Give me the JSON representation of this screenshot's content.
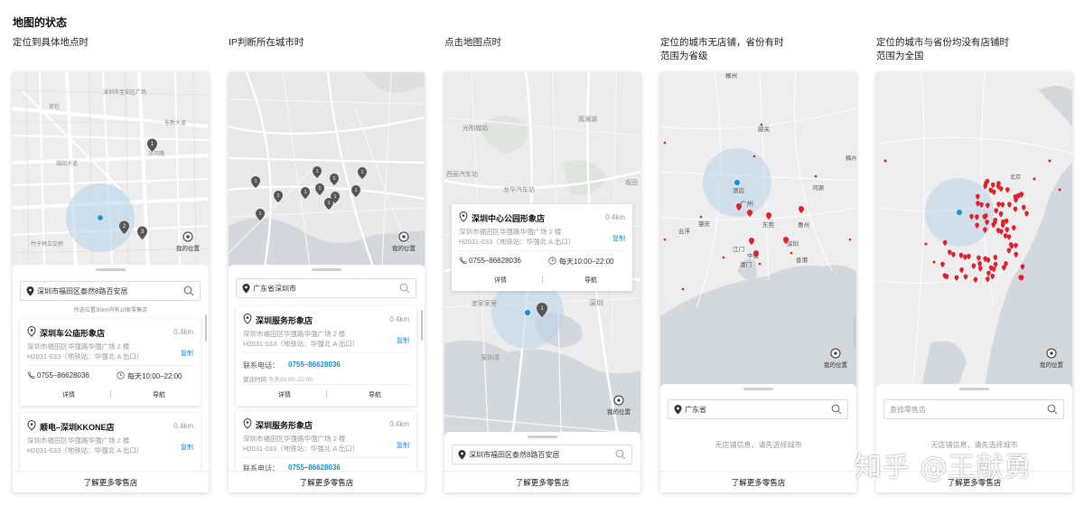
{
  "title": "地图的状态",
  "columns": [
    {
      "caption": [
        "定位到具体地点时"
      ],
      "map_labels": [
        "深圳市宝安区广场",
        "荷包",
        "福田大道",
        "沙河路",
        "东新大道",
        "竹子林立交桥"
      ],
      "search": "深圳市福田区泰然8路百安居",
      "hint": "所选位置30km内有10家零售店",
      "my_location": "我的位置",
      "stores": [
        {
          "name": "深圳车公庙形象店",
          "distance": "0.4km",
          "address": [
            "深圳市福田区华强路华强广场 2 楼",
            "H2031-033（地铁站：华强北 A 出口）"
          ],
          "copy": "复制",
          "phone": "0755–86628036",
          "hours": "每天10:00–22:00",
          "detail": "详情",
          "nav": "导航"
        },
        {
          "name": "顺电–深圳KKONE店",
          "distance": "0.4km",
          "address": [
            "深圳市福田区华强路华强广场 2 楼",
            "H2031-033（地铁站：华强北 A 出口）"
          ],
          "copy": "复制"
        }
      ],
      "cluster_counts": [
        "1",
        "2",
        "3"
      ],
      "footer": "了解更多零售店"
    },
    {
      "caption": [
        "IP判断所在城市时"
      ],
      "search": "广东省深圳市",
      "my_location": "我的位置",
      "cluster_counts": [
        "1",
        "1",
        "1",
        "1",
        "1",
        "1",
        "1",
        "1",
        "1",
        "1",
        "1"
      ],
      "stores": [
        {
          "name": "深圳服务形象店",
          "distance": "0.4km",
          "address": [
            "深圳市福田区华强路华强广场 2 楼",
            "H2031-033（地铁站：华强北 A 出口）"
          ],
          "copy": "复制",
          "contact_label": "联系电话：",
          "contact": "0755–86628036",
          "biz_label": "营业时间",
          "biz_hours": "今天10:00–22:00",
          "detail": "详情",
          "nav": "导航"
        },
        {
          "name": "深圳服务形象店",
          "distance": "0.4km",
          "address": [
            "深圳市福田区华强路华强广场 2 楼",
            "H2031-033（地铁站：华强北 A 出口）"
          ],
          "copy": "复制",
          "contact_label": "联系电话：",
          "contact": "0755–86628036"
        }
      ],
      "footer": "了解更多零售店"
    },
    {
      "caption": [
        "点击地图点时"
      ],
      "map_labels": [
        "观澜湖",
        "光明城站",
        "西丽汽车站",
        "龙华汽车站",
        "坂田",
        "深圳",
        "宜家家居",
        "深圳湾"
      ],
      "popup": {
        "name": "深圳中心公园形象店",
        "distance": "0.4km",
        "address": [
          "深圳市福田区华强路华强广场 2 楼",
          "H2031-033（地铁站：华强北 A 出口）"
        ],
        "copy": "复制",
        "phone": "0755–86628036",
        "hours": "每天10:00–22:00",
        "detail": "详情",
        "nav": "导航"
      },
      "cluster_count": "1",
      "my_location": "我的位置",
      "search": "深圳市福田区泰然8路百安居",
      "footer": "了解更多零售店"
    },
    {
      "caption": [
        "定位的城市无店铺，省份有时",
        "范围为省级"
      ],
      "map_labels": [
        "郴州",
        "韶关",
        "河源",
        "清远",
        "梅州",
        "肇庆",
        "广州",
        "东莞",
        "惠州",
        "云浮",
        "江门",
        "中山",
        "深圳",
        "澳门",
        "香港"
      ],
      "my_location": "我的位置",
      "search": "广东省",
      "empty": "无店铺信息，请先选择城市",
      "footer": "了解更多零售店"
    },
    {
      "caption": [
        "定位的城市与省份均没有店铺时",
        "范围为全国"
      ],
      "map_labels": [
        "北京"
      ],
      "my_location": "我的位置",
      "search_placeholder": "查找零售店",
      "empty": "无店铺信息，请先选择城市",
      "footer": "了解更多零售店"
    }
  ],
  "watermark": "知乎 @王献勇",
  "colors": {
    "accent": "#1a8fd8",
    "pin_gray": "#555555",
    "pin_red": "#e0202c",
    "map_bg": "#eeeeee",
    "road": "#ffffff",
    "water": "#c9cfd4"
  }
}
